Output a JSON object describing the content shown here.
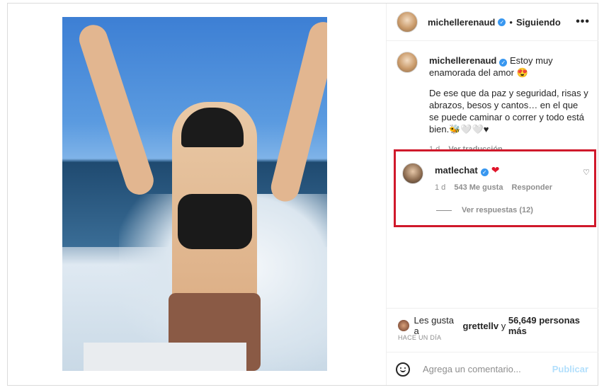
{
  "post": {
    "image_alt": "Woman on a boat with arms raised",
    "colors": {
      "verified": "#3897f0",
      "highlight_border": "#d0192b",
      "heart": "#e0152b",
      "post_disabled": "#b2dffc"
    }
  },
  "header": {
    "username": "michellerenaud",
    "separator": "•",
    "follow_status": "Siguiendo",
    "more_icon": "more-horizontal-icon",
    "more_label": "•••"
  },
  "caption": {
    "username": "michellerenaud",
    "line1": "Estoy muy enamorada del amor 😍",
    "line2": "De ese que da paz y seguridad, risas y abrazos, besos y cantos… en el que se puede caminar o correr y todo está bien.🐝🤍🤍♥",
    "time": "1 d",
    "translate": "Ver traducción"
  },
  "comment": {
    "username": "matlechat",
    "heart": "❤",
    "time": "1 d",
    "likes": "543 Me gusta",
    "reply": "Responder",
    "view_replies": "Ver respuestas (12)",
    "like_icon": "♡"
  },
  "likes": {
    "prefix": "Les gusta a",
    "user": "grettellv",
    "middle": "y",
    "count": "56,649 personas más",
    "ago": "HACE UN DÍA"
  },
  "add_comment": {
    "placeholder": "Agrega un comentario...",
    "post_label": "Publicar"
  }
}
